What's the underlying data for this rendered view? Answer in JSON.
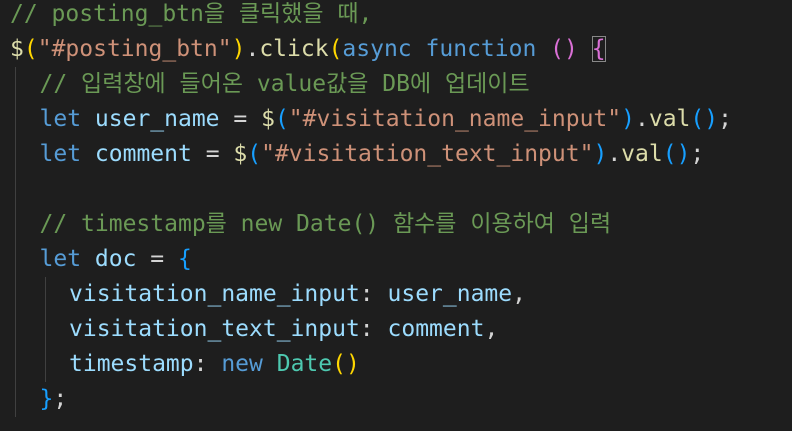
{
  "editor": {
    "lines": [
      {
        "indent": 0,
        "tokens": [
          {
            "t": "cm",
            "v": "// posting_btn을 클릭했을 때,"
          }
        ]
      },
      {
        "indent": 0,
        "tokens": [
          {
            "t": "fn",
            "v": "$"
          },
          {
            "t": "b1",
            "v": "("
          },
          {
            "t": "st",
            "v": "\"#posting_btn\""
          },
          {
            "t": "b1",
            "v": ")"
          },
          {
            "t": "pl",
            "v": "."
          },
          {
            "t": "fn",
            "v": "click"
          },
          {
            "t": "b1",
            "v": "("
          },
          {
            "t": "kw",
            "v": "async"
          },
          {
            "t": "pl",
            "v": " "
          },
          {
            "t": "kw",
            "v": "function"
          },
          {
            "t": "pl",
            "v": " "
          },
          {
            "t": "b2",
            "v": "()"
          },
          {
            "t": "pl",
            "v": " "
          },
          {
            "t": "b2-match",
            "v": "{"
          }
        ]
      },
      {
        "indent": 1,
        "tokens": [
          {
            "t": "cm",
            "v": "// 입력창에 들어온 value값을 DB에 업데이트"
          }
        ]
      },
      {
        "indent": 1,
        "tokens": [
          {
            "t": "kw",
            "v": "let"
          },
          {
            "t": "pl",
            "v": " "
          },
          {
            "t": "vr",
            "v": "user_name"
          },
          {
            "t": "pl",
            "v": " = "
          },
          {
            "t": "fn",
            "v": "$"
          },
          {
            "t": "b3",
            "v": "("
          },
          {
            "t": "st",
            "v": "\"#visitation_name_input\""
          },
          {
            "t": "b3",
            "v": ")"
          },
          {
            "t": "pl",
            "v": "."
          },
          {
            "t": "fn",
            "v": "val"
          },
          {
            "t": "b3",
            "v": "()"
          },
          {
            "t": "pl",
            "v": ";"
          }
        ]
      },
      {
        "indent": 1,
        "tokens": [
          {
            "t": "kw",
            "v": "let"
          },
          {
            "t": "pl",
            "v": " "
          },
          {
            "t": "vr",
            "v": "comment"
          },
          {
            "t": "pl",
            "v": " = "
          },
          {
            "t": "fn",
            "v": "$"
          },
          {
            "t": "b3",
            "v": "("
          },
          {
            "t": "st",
            "v": "\"#visitation_text_input\""
          },
          {
            "t": "b3",
            "v": ")"
          },
          {
            "t": "pl",
            "v": "."
          },
          {
            "t": "fn",
            "v": "val"
          },
          {
            "t": "b3",
            "v": "()"
          },
          {
            "t": "pl",
            "v": ";"
          }
        ]
      },
      {
        "indent": 1,
        "tokens": []
      },
      {
        "indent": 1,
        "tokens": [
          {
            "t": "cm",
            "v": "// timestamp를 new Date() 함수를 이용하여 입력"
          }
        ]
      },
      {
        "indent": 1,
        "tokens": [
          {
            "t": "kw",
            "v": "let"
          },
          {
            "t": "pl",
            "v": " "
          },
          {
            "t": "vr",
            "v": "doc"
          },
          {
            "t": "pl",
            "v": " = "
          },
          {
            "t": "b3",
            "v": "{"
          }
        ]
      },
      {
        "indent": 2,
        "tokens": [
          {
            "t": "vr",
            "v": "visitation_name_input"
          },
          {
            "t": "pl",
            "v": ": "
          },
          {
            "t": "vr",
            "v": "user_name"
          },
          {
            "t": "pl",
            "v": ","
          }
        ]
      },
      {
        "indent": 2,
        "tokens": [
          {
            "t": "vr",
            "v": "visitation_text_input"
          },
          {
            "t": "pl",
            "v": ": "
          },
          {
            "t": "vr",
            "v": "comment"
          },
          {
            "t": "pl",
            "v": ","
          }
        ]
      },
      {
        "indent": 2,
        "tokens": [
          {
            "t": "vr",
            "v": "timestamp"
          },
          {
            "t": "pl",
            "v": ": "
          },
          {
            "t": "kw",
            "v": "new"
          },
          {
            "t": "pl",
            "v": " "
          },
          {
            "t": "ty",
            "v": "Date"
          },
          {
            "t": "b1",
            "v": "()"
          }
        ]
      },
      {
        "indent": 1,
        "tokens": [
          {
            "t": "b3",
            "v": "}"
          },
          {
            "t": "pl",
            "v": ";"
          }
        ]
      }
    ]
  }
}
